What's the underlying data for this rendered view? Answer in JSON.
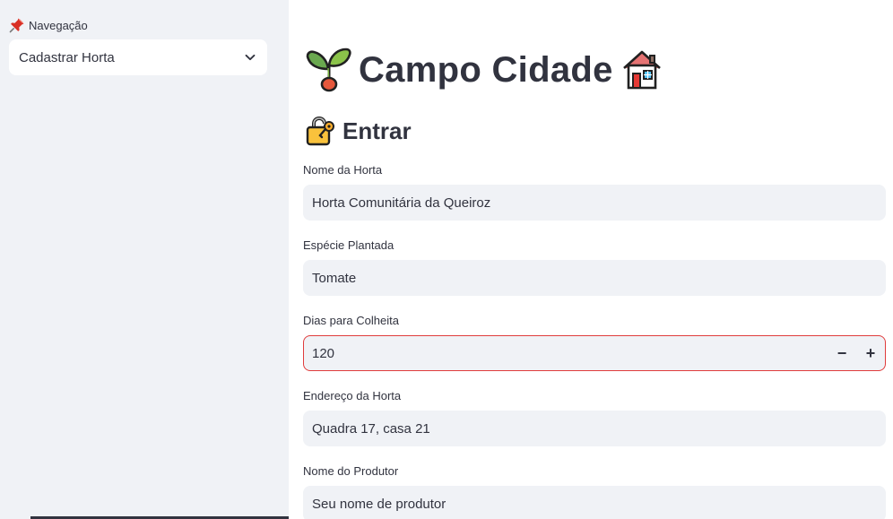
{
  "sidebar": {
    "nav_label": "Navegação",
    "nav_icon": "pushpin-icon",
    "select": {
      "value": "Cadastrar Horta",
      "icon": "chevron-down-icon"
    }
  },
  "main": {
    "title": "Campo Cidade",
    "title_icons": [
      "seedling-icon",
      "house-icon"
    ],
    "subtitle": "Entrar",
    "subtitle_icon": "lock-with-key-icon",
    "fields": {
      "nome_horta": {
        "label": "Nome da Horta",
        "value": "Horta Comunitária da Queiroz"
      },
      "especie": {
        "label": "Espécie Plantada",
        "value": "Tomate"
      },
      "dias": {
        "label": "Dias para Colheita",
        "value": "120",
        "minus": "−",
        "plus": "+"
      },
      "endereco": {
        "label": "Endereço da Horta",
        "value": "Quadra 17, casa 21"
      },
      "produtor": {
        "label": "Nome do Produtor",
        "placeholder": "Seu nome de produtor"
      }
    }
  },
  "colors": {
    "sidebar_bg": "#f0f2f6",
    "input_bg": "#f0f2f6",
    "text": "#31333f",
    "error_border": "#e03c3c"
  }
}
